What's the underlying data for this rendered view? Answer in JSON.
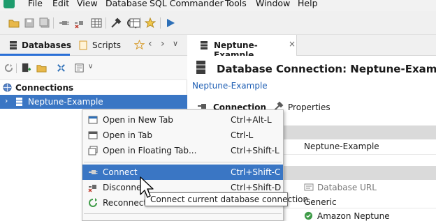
{
  "menubar": {
    "items": [
      "File",
      "Edit",
      "View",
      "Database",
      "SQL Commander",
      "Tools",
      "Window",
      "Help"
    ]
  },
  "toolbar": {
    "icons": [
      "open-folder-icon",
      "save-icon",
      "save-all-icon",
      "connect-icon",
      "disconnect-icon",
      "grid-icon",
      "tools-icon",
      "settings-icon",
      "table-icon",
      "favorites-icon",
      "execute-icon"
    ]
  },
  "left_panel": {
    "tabs": [
      {
        "label": "Databases",
        "icon": "database-icon"
      },
      {
        "label": "Scripts",
        "icon": "scripts-icon"
      }
    ],
    "tree": {
      "header": "Connections",
      "items": [
        {
          "label": "Neptune-Example"
        }
      ]
    }
  },
  "right_panel": {
    "tab_title": "Neptune-Example",
    "page_title": "Database Connection: Neptune-Example",
    "breadcrumb": "Neptune-Example",
    "subtabs": [
      "Connection",
      "Properties"
    ],
    "fields": {
      "name_value": "Neptune-Example",
      "url_label": "Database URL",
      "generic_value": "Generic",
      "driver_value": "Amazon Neptune"
    }
  },
  "context_menu": {
    "items": [
      {
        "label": "Open in New Tab",
        "shortcut": "Ctrl+Alt-L"
      },
      {
        "label": "Open in Tab",
        "shortcut": "Ctrl-L"
      },
      {
        "label": "Open in Floating Tab...",
        "shortcut": "Ctrl+Shift-L"
      },
      {
        "label": "Connect",
        "shortcut": "Ctrl+Shift-C"
      },
      {
        "label": "Disconnect",
        "shortcut": "Ctrl+Shift-D"
      },
      {
        "label": "Reconnect",
        "shortcut": ""
      }
    ]
  },
  "tooltip": {
    "text": "Connect current database connection"
  },
  "colors": {
    "selection": "#3a76c4",
    "link": "#1f5fb4",
    "tab_accent": "#2a6fd6",
    "app_green": "#1e9c6d"
  }
}
